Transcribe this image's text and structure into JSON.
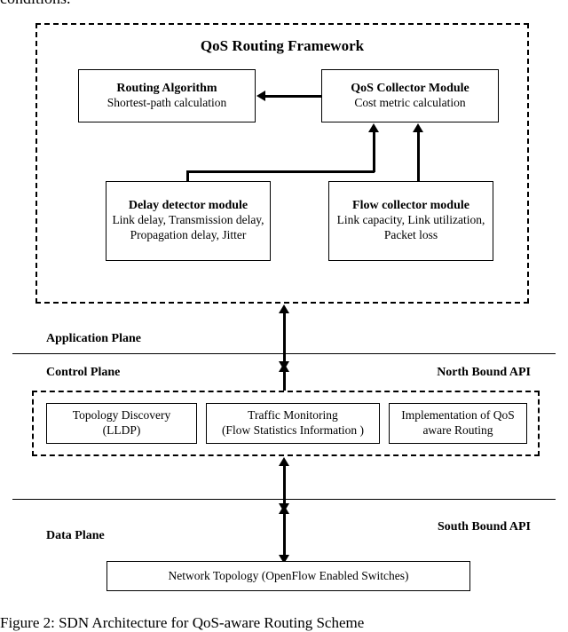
{
  "cropped_text": "conditions.",
  "framework": {
    "title": "QoS Routing Framework",
    "routing_algorithm": {
      "title": "Routing Algorithm",
      "sub": "Shortest-path calculation"
    },
    "qos_collector": {
      "title": "QoS Collector Module",
      "sub": "Cost metric calculation"
    },
    "delay_detector": {
      "title": "Delay detector module",
      "sub": "Link delay, Transmission delay, Propagation delay, Jitter"
    },
    "flow_collector": {
      "title": "Flow collector module",
      "sub": "Link capacity, Link utilization, Packet loss"
    }
  },
  "planes": {
    "application": "Application Plane",
    "control": "Control Plane",
    "data": "Data Plane",
    "north_api": "North Bound API",
    "south_api": "South Bound API"
  },
  "control_boxes": {
    "topology": {
      "l1": "Topology Discovery",
      "l2": "(LLDP)"
    },
    "traffic": {
      "l1": "Traffic Monitoring",
      "l2": "(Flow Statistics Information )"
    },
    "qos_routing": {
      "l1": "Implementation of QoS",
      "l2": "aware Routing"
    }
  },
  "data_box": {
    "label": "Network Topology (OpenFlow Enabled Switches)"
  },
  "caption": "Figure 2: SDN Architecture for QoS-aware Routing Scheme"
}
